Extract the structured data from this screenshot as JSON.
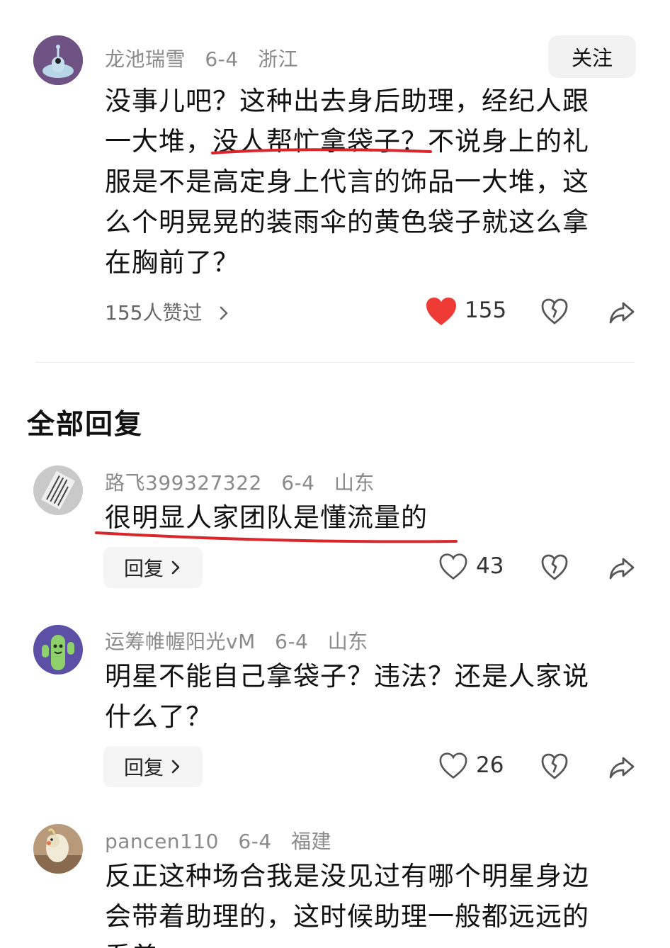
{
  "main_comment": {
    "username": "龙池瑞雪",
    "date": "6-4",
    "location": "浙江",
    "follow_label": "关注",
    "text_lines": [
      "没事儿吧？这种出去身后助理，经纪人跟",
      "一大堆，没人帮忙拿袋子？不说身上的礼",
      "服是不是高定身上代言的饰品一大堆，这",
      "么个明晃晃的装雨伞的黄色袋子就这么拿",
      "在胸前了？"
    ],
    "liked_by_label": "155人赞过",
    "likes": "155",
    "heart_color": "#ef3b36"
  },
  "section_title": "全部回复",
  "replies": [
    {
      "username": "路飞399327322",
      "date": "6-4",
      "location": "山东",
      "text_lines": [
        "很明显人家团队是懂流量的"
      ],
      "reply_label": "回复",
      "likes": "43"
    },
    {
      "username": "运筹帷幄阳光vM",
      "date": "6-4",
      "location": "山东",
      "text_lines": [
        "明星不能自己拿袋子？违法？还是人家说",
        "什么了？"
      ],
      "reply_label": "回复",
      "likes": "26"
    },
    {
      "username": "pancen110",
      "date": "6-4",
      "location": "福建",
      "text_lines": [
        "反正这种场合我是没见过有哪个明星身边",
        "会带着助理的，这时候助理一般都远远的",
        "看着"
      ]
    }
  ],
  "annotation_color": "#d8262a"
}
